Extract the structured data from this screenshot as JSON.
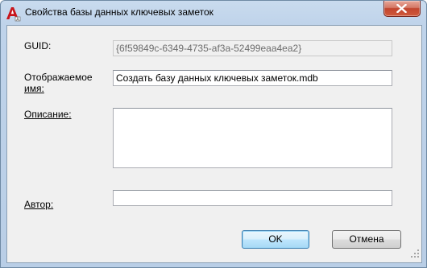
{
  "window": {
    "title": "Свойства базы данных ключевых заметок",
    "app_icon": "autocad-a-icon",
    "close_icon": "close-x-icon"
  },
  "fields": {
    "guid": {
      "label": "GUID:",
      "value": "{6f59849c-6349-4735-af3a-52499eaa4ea2}"
    },
    "display_name": {
      "label_line1": "Отображаемое",
      "label_line2": "имя:",
      "value": "Создать базу данных ключевых заметок.mdb"
    },
    "description": {
      "label": "Описание:",
      "value": ""
    },
    "author": {
      "label": "Автор:",
      "value": ""
    }
  },
  "buttons": {
    "ok": "OK",
    "cancel": "Отмена"
  },
  "colors": {
    "frame": "#bfd3ea",
    "client": "#f0f0f0",
    "close_button": "#c2452e",
    "default_button_border": "#3c7fb1"
  }
}
